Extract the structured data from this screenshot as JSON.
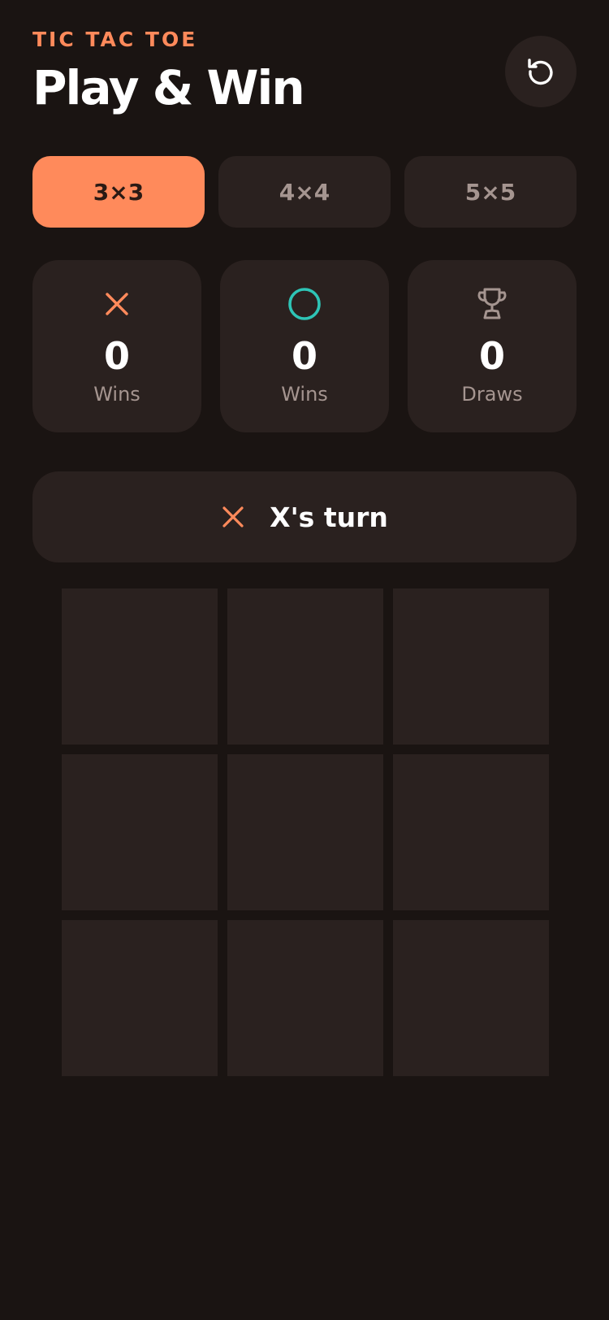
{
  "header": {
    "eyebrow": "TIC TAC TOE",
    "title": "Play & Win",
    "reset_icon": "refresh-icon"
  },
  "sizes": [
    {
      "label": "3×3",
      "active": true
    },
    {
      "label": "4×4",
      "active": false
    },
    {
      "label": "5×5",
      "active": false
    }
  ],
  "scores": [
    {
      "icon": "x-icon",
      "value": "0",
      "label": "Wins"
    },
    {
      "icon": "o-icon",
      "value": "0",
      "label": "Wins"
    },
    {
      "icon": "trophy-icon",
      "value": "0",
      "label": "Draws"
    }
  ],
  "status": {
    "icon": "x-icon",
    "text": "X's turn"
  },
  "board": {
    "rows": 3,
    "cols": 3,
    "cells": [
      "",
      "",
      "",
      "",
      "",
      "",
      "",
      "",
      ""
    ]
  },
  "colors": {
    "background": "#1a1412",
    "surface": "#2a211f",
    "accent_x": "#ff8a5b",
    "accent_o": "#2ec4b6",
    "muted": "#a59590"
  }
}
